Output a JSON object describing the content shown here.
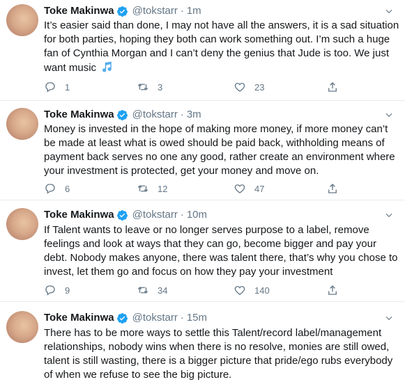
{
  "tweets": [
    {
      "name": "Toke Makinwa",
      "handle": "@tokstarr",
      "time": "1m",
      "text": "It’s easier said than done, I may not have all the answers, it is a sad situation for both parties, hoping they both can work something out. I’m such a huge fan of Cynthia Morgan and I can’t deny the genius that Jude is too. We just want music",
      "emoji": "musical-note",
      "replies": "1",
      "retweets": "3",
      "likes": "23"
    },
    {
      "name": "Toke Makinwa",
      "handle": "@tokstarr",
      "time": "3m",
      "text": "Money is invested in the hope of making more money, if more money can’t be made at least what is owed should be paid back, withholding means of payment back serves no one any good, rather create an environment where your investment is protected, get your money and move on.",
      "replies": "6",
      "retweets": "12",
      "likes": "47"
    },
    {
      "name": "Toke Makinwa",
      "handle": "@tokstarr",
      "time": "10m",
      "text": "If Talent wants to leave or no longer serves purpose to a label, remove feelings and look at ways that they can go, become bigger and pay your debt. Nobody makes anyone, there was talent there, that’s why you chose to invest, let them go and focus on how they pay your investment",
      "replies": "9",
      "retweets": "34",
      "likes": "140"
    },
    {
      "name": "Toke Makinwa",
      "handle": "@tokstarr",
      "time": "15m",
      "text": "There has to be more ways to settle this Talent/record label/management relationships, nobody wins when there is no resolve, monies are still owed, talent is still wasting, there is a bigger picture that pride/ego rubs everybody of when we refuse to see the big picture."
    }
  ],
  "icons": {
    "verified": "verified-badge-icon",
    "more": "chevron-down-icon",
    "reply": "reply-icon",
    "retweet": "retweet-icon",
    "like": "heart-icon",
    "share": "share-icon"
  },
  "colors": {
    "verified_blue": "#1da1f2",
    "secondary_text": "#657786",
    "primary_text": "#14171a",
    "divider": "#e6ecf0"
  }
}
